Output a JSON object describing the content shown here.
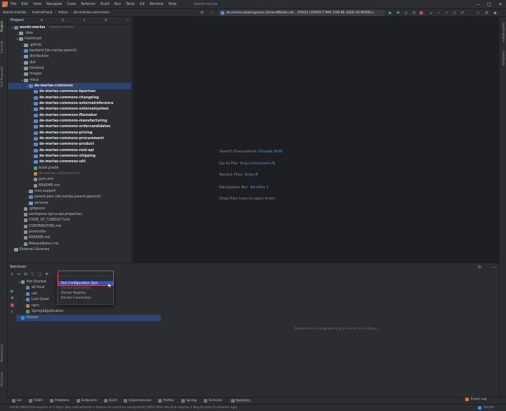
{
  "titlebar": {
    "menu": [
      "File",
      "Edit",
      "View",
      "Navigate",
      "Code",
      "Refactor",
      "Build",
      "Run",
      "Tools",
      "Git",
      "Window",
      "Help"
    ],
    "title": "wonki-merlas"
  },
  "navbar": {
    "crumbs": [
      "wonki-merlas",
      "mainwfrack",
      "mbus",
      "de-merlas-commons"
    ],
    "run_config": "de.merlas.banking.base.GeneralModel.nat... (FAILIS CORRECT MAY CAN BE USED AS MODEL)",
    "window_controls": [
      "—",
      "□",
      "✕"
    ]
  },
  "left_strip": [
    "Project",
    "Commit",
    "Pull Requests"
  ],
  "left_strip_bottom": [
    "Bookmarks",
    "Structure"
  ],
  "right_strip": [
    "Notifications",
    "Database"
  ],
  "project": {
    "title": "Project",
    "tree": [
      {
        "indent": 0,
        "chev": "▾",
        "icon": "modfolder",
        "label": "wonki-merlas",
        "suffix": "~/wonki-merlas",
        "style": "bold"
      },
      {
        "indent": 1,
        "chev": "›",
        "icon": "folder",
        "label": ".idea"
      },
      {
        "indent": 1,
        "chev": "▾",
        "icon": "folder",
        "label": "mainfrack"
      },
      {
        "indent": 2,
        "chev": "›",
        "icon": "folder",
        "label": ".github"
      },
      {
        "indent": 2,
        "chev": "›",
        "icon": "modfolder",
        "label": "backend [de.merlas.parent]"
      },
      {
        "indent": 2,
        "chev": "›",
        "icon": "folder",
        "label": "distribution"
      },
      {
        "indent": 2,
        "chev": "›",
        "icon": "folder",
        "label": "dist"
      },
      {
        "indent": 2,
        "chev": "›",
        "icon": "folder",
        "label": "frontend"
      },
      {
        "indent": 2,
        "chev": "›",
        "icon": "folder",
        "label": "images"
      },
      {
        "indent": 2,
        "chev": "▾",
        "icon": "folder",
        "label": "mbus"
      },
      {
        "indent": 3,
        "chev": "▾",
        "icon": "modfolder",
        "label": "de-merlas-commons",
        "style": "bold",
        "selected": true
      },
      {
        "indent": 4,
        "chev": "›",
        "icon": "modfolder",
        "label": "de-merlas-commons-bpartner",
        "style": "bold"
      },
      {
        "indent": 4,
        "chev": "›",
        "icon": "modfolder",
        "label": "de-merlas-commons-changelog",
        "style": "bold"
      },
      {
        "indent": 4,
        "chev": "›",
        "icon": "modfolder",
        "label": "de-merlas-commons-externalreference",
        "style": "bold"
      },
      {
        "indent": 4,
        "chev": "›",
        "icon": "modfolder",
        "label": "de-merlas-commons-externalsystem",
        "style": "bold"
      },
      {
        "indent": 4,
        "chev": "›",
        "icon": "modfolder",
        "label": "de-merlas-commons-filemaker",
        "style": "bold"
      },
      {
        "indent": 4,
        "chev": "›",
        "icon": "modfolder",
        "label": "de-merlas-commons-manufacturing",
        "style": "bold"
      },
      {
        "indent": 4,
        "chev": "›",
        "icon": "modfolder",
        "label": "de-merlas-commons-ordercandidates",
        "style": "bold"
      },
      {
        "indent": 4,
        "chev": "›",
        "icon": "modfolder",
        "label": "de-merlas-commons-pricing",
        "style": "bold"
      },
      {
        "indent": 4,
        "chev": "›",
        "icon": "modfolder",
        "label": "de-merlas-commons-procurement",
        "style": "bold"
      },
      {
        "indent": 4,
        "chev": "›",
        "icon": "modfolder",
        "label": "de-merlas-commons-product",
        "style": "bold"
      },
      {
        "indent": 4,
        "chev": "›",
        "icon": "modfolder",
        "label": "de-merlas-commons-rest-api",
        "style": "bold"
      },
      {
        "indent": 4,
        "chev": "›",
        "icon": "modfolder",
        "label": "de-merlas-commons-shipping",
        "style": "bold"
      },
      {
        "indent": 4,
        "chev": "›",
        "icon": "modfolder",
        "label": "de-merlas-commons-util",
        "style": "bold"
      },
      {
        "indent": 4,
        "chev": "",
        "icon": "gfile",
        "label": "build.gradle"
      },
      {
        "indent": 4,
        "chev": "",
        "icon": "ofile",
        "label": "de-merlas-commons.iml",
        "style": "dim"
      },
      {
        "indent": 4,
        "chev": "",
        "icon": "file",
        "label": "pom.xml"
      },
      {
        "indent": 4,
        "chev": "",
        "icon": "file",
        "label": "README.md"
      },
      {
        "indent": 3,
        "chev": "›",
        "icon": "folder",
        "label": "mvc-support"
      },
      {
        "indent": 3,
        "chev": "›",
        "icon": "modfolder",
        "label": "parent-pom [de.merlas.parent.general]"
      },
      {
        "indent": 3,
        "chev": "›",
        "icon": "folder",
        "label": "services"
      },
      {
        "indent": 2,
        "chev": "",
        "icon": "file",
        "label": ".gitignore"
      },
      {
        "indent": 2,
        "chev": "",
        "icon": "file",
        "label": "workspace-opt-a-opt.properties"
      },
      {
        "indent": 2,
        "chev": "",
        "icon": "file",
        "label": "CODE_OF_CONDUCT.md"
      },
      {
        "indent": 2,
        "chev": "",
        "icon": "file",
        "label": "CONTRIBUTING.md"
      },
      {
        "indent": 2,
        "chev": "",
        "icon": "file",
        "label": "Jenkinsfile"
      },
      {
        "indent": 2,
        "chev": "",
        "icon": "file",
        "label": "README.md"
      },
      {
        "indent": 2,
        "chev": "",
        "icon": "file",
        "label": "ReleaseNotes.md"
      },
      {
        "indent": 0,
        "chev": "›",
        "icon": "folder",
        "label": "External Libraries"
      }
    ]
  },
  "editor": {
    "hints": [
      {
        "label": "Search Everywhere",
        "key": "Double Shift"
      },
      {
        "label": "Go to File",
        "key": "Strg+Umschalt+N"
      },
      {
        "label": "Recent Files",
        "key": "Strg+E"
      },
      {
        "label": "Navigation Bar",
        "key": "Alt+Pos 1"
      },
      {
        "label": "Drop files here to open them",
        "key": ""
      }
    ]
  },
  "services": {
    "title": "Services",
    "tree": [
      {
        "indent": 0,
        "chev": "▾",
        "label": "Not Started",
        "color": "#8c8f94"
      },
      {
        "indent": 1,
        "chev": "›",
        "label": "all-local",
        "color": "#5f86c4"
      },
      {
        "indent": 1,
        "chev": "›",
        "label": "uat",
        "color": "#5f86c4"
      },
      {
        "indent": 1,
        "chev": "›",
        "label": "Live Quad",
        "color": "#5f86c4"
      },
      {
        "indent": 1,
        "chev": "›",
        "label": "npm",
        "color": "#c9803c"
      },
      {
        "indent": 1,
        "chev": "",
        "label": "SpringbApplication",
        "color": "#4aa65a"
      },
      {
        "indent": 0,
        "chev": "›",
        "label": "Docker",
        "color": "#2496ed",
        "selected": true
      }
    ],
    "empty_message": "Double-click or drag-and-drop a service to configure"
  },
  "popup": {
    "items": [
      {
        "label": "Run Configuration Type",
        "state": "highlighted"
      },
      {
        "label": "Docker Connection",
        "state": "disabled"
      },
      {
        "label": "Docker Registry",
        "state": "normal"
      },
      {
        "label": "Docker Connection",
        "state": "normal"
      }
    ]
  },
  "tooltabs": [
    "Git",
    "TODO",
    "Problems",
    "Endpoints",
    "Build",
    "Dependencies",
    "Profiler",
    "Spring",
    "Terminal",
    "Services"
  ],
  "tooltabs_active": "Services",
  "tooltabs_right": "Event Log",
  "statusbar": {
    "message": "IntelliJ IDEA trial expires in 3 days: Buy and activate a license to continue using IntelliJ IDEA after the trial expires // Buy license (2 minutes ago)",
    "right": "Docker"
  }
}
